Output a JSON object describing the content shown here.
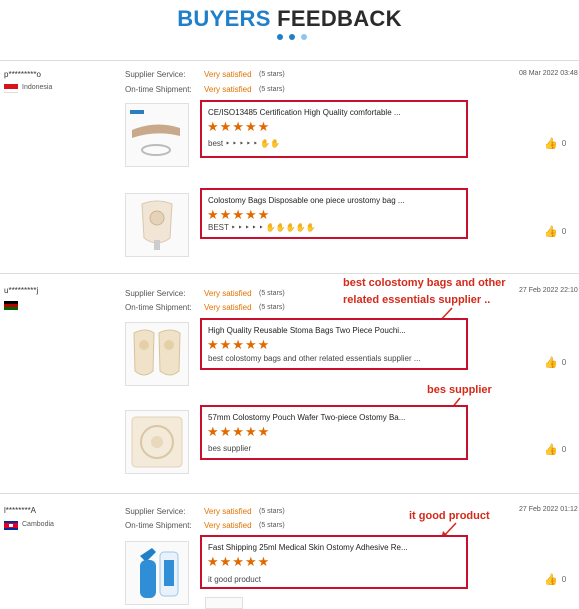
{
  "header": {
    "title_part1": "BUYERS",
    "title_part2": "FEEDBACK"
  },
  "colors": {
    "accent_blue": "#1f7fc9",
    "highlight_red": "#c8102e",
    "star_orange": "#e06a00",
    "satisfied_orange": "#e07200"
  },
  "labels": {
    "supplier_service": "Supplier Service:",
    "on_time_shipment": "On-time Shipment:"
  },
  "reviews": [
    {
      "user": "p*********o",
      "country": "Indonesia",
      "date": "08 Mar 2022 03:48",
      "supplier_service": "Very satisfied",
      "supplier_stars": "(5 stars)",
      "shipment": "Very satisfied",
      "shipment_stars": "(5 stars)",
      "products": [
        {
          "title": "CE/ISO13485 Certification High Quality comfortable ...",
          "rating": "★★★★★",
          "rating_value": 5,
          "comment": "best ‣ ‣ ‣ ‣ ‣ ✋✋",
          "likes": "0"
        },
        {
          "title": "Colostomy Bags Disposable one piece urostomy bag ...",
          "rating": "★★★★★",
          "rating_value": 5,
          "comment": "BEST ‣ ‣ ‣ ‣ ‣ ✋✋✋✋✋",
          "likes": "0"
        }
      ]
    },
    {
      "user": "u*********j",
      "country": "",
      "date": "27 Feb 2022 22:10",
      "supplier_service": "Very satisfied",
      "supplier_stars": "(5 stars)",
      "shipment": "Very satisfied",
      "shipment_stars": "(5 stars)",
      "products": [
        {
          "title": "High Quality Reusable Stoma Bags Two Piece Pouchi...",
          "rating": "★★★★★",
          "rating_value": 5,
          "comment": "best colostomy bags and other related essentials supplier ...",
          "likes": "0"
        },
        {
          "title": "57mm Colostomy Pouch Wafer Two-piece Ostomy Ba...",
          "rating": "★★★★★",
          "rating_value": 5,
          "comment": "bes supplier",
          "likes": "0"
        }
      ]
    },
    {
      "user": "l********A",
      "country": "Cambodia",
      "date": "27 Feb 2022 01:12",
      "supplier_service": "Very satisfied",
      "supplier_stars": "(5 stars)",
      "shipment": "Very satisfied",
      "shipment_stars": "(5 stars)",
      "products": [
        {
          "title": "Fast Shipping 25ml Medical Skin Ostomy Adhesive Re...",
          "rating": "★★★★★",
          "rating_value": 5,
          "comment": "it good product",
          "likes": "0"
        }
      ]
    }
  ],
  "annotations": {
    "a1_line1": "best colostomy bags and other",
    "a1_line2": "related essentials supplier ..",
    "a2": "bes supplier",
    "a3": "it good product"
  }
}
